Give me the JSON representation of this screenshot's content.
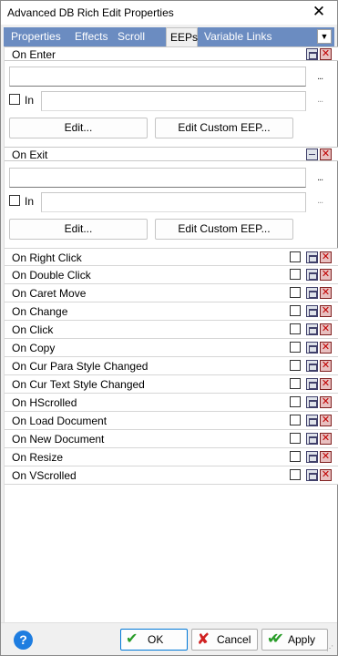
{
  "window": {
    "title": "Advanced DB Rich Edit Properties"
  },
  "tabs": [
    {
      "label": "Properties"
    },
    {
      "label": "Effects"
    },
    {
      "label": "Scroll Bars"
    },
    {
      "label": "EEPs"
    },
    {
      "label": "Variable Links"
    }
  ],
  "active_tab": "EEPs",
  "sections": [
    {
      "label": "On Enter",
      "in_label": "In",
      "in_checked": false,
      "edit_label": "Edit...",
      "custom_label": "Edit Custom EEP...",
      "ellipsis": "..."
    },
    {
      "label": "On Exit",
      "in_label": "In",
      "in_checked": false,
      "edit_label": "Edit...",
      "custom_label": "Edit Custom EEP...",
      "ellipsis": "..."
    }
  ],
  "events": [
    {
      "label": "On Right Click",
      "checked": false
    },
    {
      "label": "On Double Click",
      "checked": false
    },
    {
      "label": "On Caret Move",
      "checked": false
    },
    {
      "label": "On Change",
      "checked": false
    },
    {
      "label": "On Click",
      "checked": false
    },
    {
      "label": "On Copy",
      "checked": false
    },
    {
      "label": "On Cur Para Style Changed",
      "checked": false
    },
    {
      "label": "On Cur Text Style Changed",
      "checked": false
    },
    {
      "label": "On HScrolled",
      "checked": false
    },
    {
      "label": "On Load Document",
      "checked": false
    },
    {
      "label": "On New Document",
      "checked": false
    },
    {
      "label": "On Resize",
      "checked": false
    },
    {
      "label": "On VScrolled",
      "checked": false
    }
  ],
  "footer": {
    "help_glyph": "?",
    "ok_label": "OK",
    "cancel_label": "Cancel",
    "apply_label": "Apply"
  },
  "colors": {
    "tabbar": "#6b8cc1",
    "ok_border": "#0078d7",
    "ok_check": "#2a9d2a",
    "cancel_x": "#d02020",
    "help": "#1e7de0"
  },
  "icons": {
    "close": "close-icon",
    "tab_dropdown": "chevron-down-icon",
    "minimize": "minimize-icon",
    "window": "window-icon",
    "delete": "delete-icon",
    "help": "help-icon",
    "ok": "check-icon",
    "cancel": "x-icon",
    "apply": "double-check-icon"
  }
}
